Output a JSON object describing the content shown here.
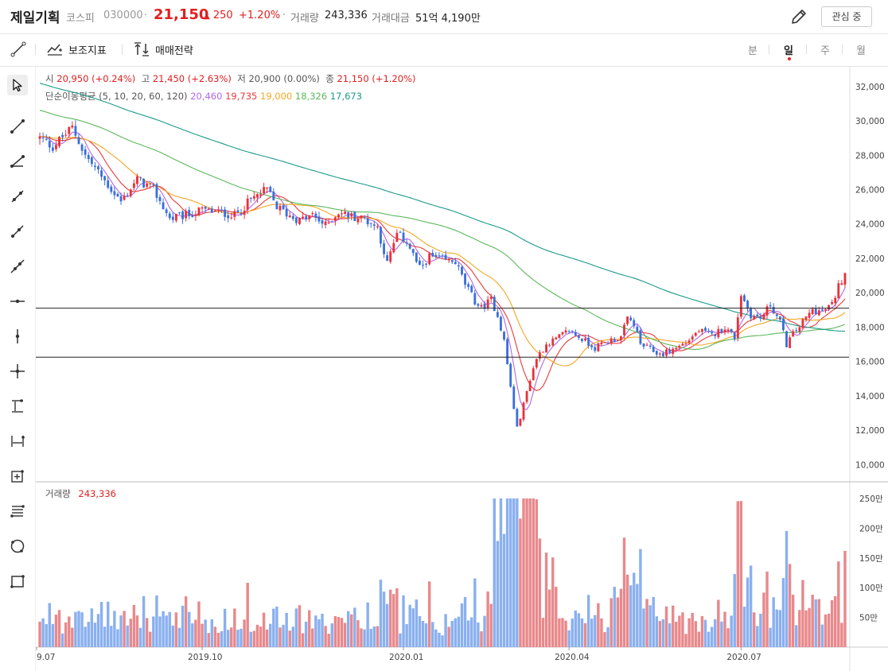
{
  "header": {
    "name": "제일기획",
    "market": "코스피",
    "code": "030000",
    "dot": "·",
    "price": "21,150",
    "change_arrow": "▲",
    "change": "250",
    "change_pct": "+1.20%",
    "volume_label": "거래량",
    "volume": "243,336",
    "amount_label": "거래대금",
    "amount": "51억 4,190만",
    "watch_label": "관심 중",
    "edit_icon": "pencil-icon",
    "up_color": "#e02020"
  },
  "toolbar": {
    "indicator_label": "보조지표",
    "strategy_label": "매매전략",
    "periods": [
      "분",
      "일",
      "주",
      "월"
    ],
    "active_period": "일"
  },
  "left_tools": [
    "cursor-icon",
    "line-icon",
    "angle-line-icon",
    "segment-icon",
    "ray-icon",
    "extended-line-icon",
    "horizontal-line-icon",
    "vertical-line-icon",
    "crosshair-icon",
    "price-range-icon",
    "date-range-icon",
    "add-box-icon",
    "fib-lines-icon",
    "circle-icon",
    "rectangle-icon"
  ],
  "price_info": {
    "open_label": "시",
    "open": "20,950 (+0.24%)",
    "high_label": "고",
    "high": "21,450 (+2.63%)",
    "low_label": "저",
    "low": "20,900 (0.00%)",
    "close_label": "종",
    "close": "21,150 (+1.20%)"
  },
  "ma_info": {
    "label": "단순이동평균 (5, 10, 20, 60, 120)",
    "values": [
      "20,460",
      "19,735",
      "19,000",
      "18,326",
      "17,673"
    ],
    "colors": [
      "#b467e6",
      "#e83a3a",
      "#f5a623",
      "#5cb85c",
      "#1a9a8a"
    ]
  },
  "volume_info": {
    "label": "거래량",
    "value": "243,336"
  },
  "chart_data": {
    "type": "candlestick",
    "price_axis": {
      "ticks": [
        "32,000",
        "30,000",
        "28,000",
        "26,000",
        "24,000",
        "22,000",
        "20,000",
        "18,000",
        "16,000",
        "14,000",
        "12,000",
        "10,000"
      ],
      "range": [
        9000,
        32500
      ]
    },
    "volume_axis": {
      "ticks": [
        "250만",
        "200만",
        "150만",
        "100만",
        "50만"
      ],
      "range": [
        0,
        270
      ]
    },
    "x_ticks": [
      "9.07",
      "2019.10",
      "2020.01",
      "2020.04",
      "2020.07"
    ],
    "horizontal_lines": [
      19100,
      16250
    ],
    "colors": {
      "up": "#e8323c",
      "down": "#3a6fdc",
      "vol_up": "#e8898c",
      "vol_down": "#8ab0ef"
    },
    "path": [
      [
        0,
        29000
      ],
      [
        4,
        28500
      ],
      [
        10,
        29600
      ],
      [
        14,
        28000
      ],
      [
        20,
        26500
      ],
      [
        25,
        25300
      ],
      [
        30,
        26600
      ],
      [
        35,
        26000
      ],
      [
        40,
        24300
      ],
      [
        45,
        24500
      ],
      [
        50,
        24800
      ],
      [
        55,
        24700
      ],
      [
        60,
        24500
      ],
      [
        65,
        25400
      ],
      [
        70,
        26000
      ],
      [
        73,
        25000
      ],
      [
        76,
        24600
      ],
      [
        80,
        24200
      ],
      [
        84,
        24500
      ],
      [
        88,
        23900
      ],
      [
        92,
        24700
      ],
      [
        95,
        24500
      ],
      [
        100,
        24300
      ],
      [
        104,
        23800
      ],
      [
        107,
        21700
      ],
      [
        110,
        23400
      ],
      [
        113,
        23000
      ],
      [
        117,
        21400
      ],
      [
        120,
        22100
      ],
      [
        124,
        21900
      ],
      [
        128,
        21800
      ],
      [
        131,
        20500
      ],
      [
        134,
        19500
      ],
      [
        136,
        19100
      ],
      [
        139,
        19600
      ],
      [
        141,
        18700
      ],
      [
        143,
        17200
      ],
      [
        145,
        14500
      ],
      [
        147,
        12100
      ],
      [
        149,
        13500
      ],
      [
        151,
        15000
      ],
      [
        153,
        16200
      ],
      [
        156,
        17000
      ],
      [
        159,
        17300
      ],
      [
        163,
        17800
      ],
      [
        167,
        17300
      ],
      [
        171,
        16800
      ],
      [
        175,
        17200
      ],
      [
        179,
        17400
      ],
      [
        181,
        18500
      ],
      [
        183,
        18200
      ],
      [
        185,
        17000
      ],
      [
        188,
        16700
      ],
      [
        191,
        16400
      ],
      [
        195,
        16700
      ],
      [
        199,
        17100
      ],
      [
        203,
        17800
      ],
      [
        207,
        17500
      ],
      [
        211,
        18000
      ],
      [
        214,
        17400
      ],
      [
        216,
        19900
      ],
      [
        219,
        18700
      ],
      [
        222,
        18500
      ],
      [
        225,
        19300
      ],
      [
        228,
        18300
      ],
      [
        230,
        17000
      ],
      [
        232,
        17600
      ],
      [
        235,
        18300
      ],
      [
        238,
        19000
      ],
      [
        241,
        18900
      ],
      [
        244,
        19300
      ],
      [
        246,
        20400
      ],
      [
        248,
        21100
      ]
    ],
    "n_candles": 249,
    "last_close": 21150
  }
}
